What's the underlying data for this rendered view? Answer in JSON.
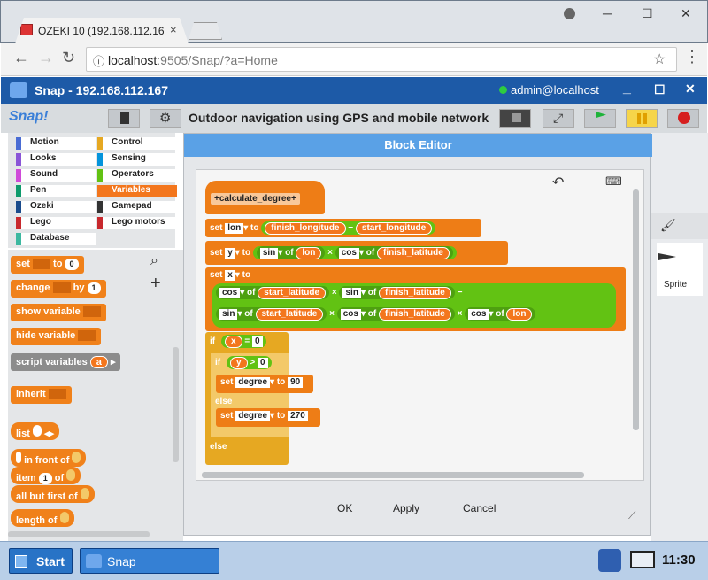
{
  "browser": {
    "tab_title": "OZEKI 10 (192.168.112.16",
    "tab_close": "×",
    "url_host": "localhost",
    "url_path": ":9505/Snap/?a=Home",
    "minimize": "─",
    "maximize": "☐",
    "close": "✕"
  },
  "snap_window": {
    "title": "Snap - 192.168.112.167",
    "user": "admin@localhost",
    "project_title": "Outdoor navigation using GPS and mobile network",
    "logo": "Snap!"
  },
  "categories": [
    {
      "label": "Motion",
      "color": "#4a6cd4"
    },
    {
      "label": "Control",
      "color": "#e6a822"
    },
    {
      "label": "Looks",
      "color": "#8a55d7"
    },
    {
      "label": "Sensing",
      "color": "#0494dc"
    },
    {
      "label": "Sound",
      "color": "#cf4ad9"
    },
    {
      "label": "Operators",
      "color": "#62c213"
    },
    {
      "label": "Pen",
      "color": "#0e9a6c"
    },
    {
      "label": "Variables",
      "color": "#f3761d"
    },
    {
      "label": "Ozeki",
      "color": "#1a4b8c"
    },
    {
      "label": "Gamepad",
      "color": "#333333"
    },
    {
      "label": "Lego",
      "color": "#c8282d"
    },
    {
      "label": "Lego motors",
      "color": "#c8282d"
    },
    {
      "label": "Database",
      "color": "#3cb8a0"
    }
  ],
  "palette": {
    "set": "set",
    "to": "to",
    "set_value": "0",
    "change": "change",
    "by": "by",
    "change_value": "1",
    "show_variable": "show variable",
    "hide_variable": "hide variable",
    "script_variables": "script variables",
    "script_var_a": "a",
    "inherit": "inherit",
    "list": "list",
    "in_front_of": "in front of",
    "item": "item",
    "item_value": "1",
    "of": "of",
    "all_but_first_of": "all but first of",
    "length_of": "length of"
  },
  "dialog": {
    "title": "Block Editor",
    "hat": "+calculate_degree+",
    "set": "set",
    "to": "to",
    "var_lon": "lon",
    "var_y": "y",
    "var_x": "x",
    "finish_longitude": "finish_longitude",
    "start_longitude": "start_longitude",
    "minus": "−",
    "times": "×",
    "sin": "sin",
    "cos": "cos",
    "of": "of",
    "finish_latitude": "finish_latitude",
    "start_latitude": "start_latitude",
    "lon": "lon",
    "if": "if",
    "else": "else",
    "x": "x",
    "y": "y",
    "eq": "=",
    "gt": ">",
    "zero": "0",
    "degree": "degree",
    "ninety": "90",
    "two_seventy": "270",
    "ok": "OK",
    "apply": "Apply",
    "cancel": "Cancel"
  },
  "stage": {
    "sprite_label": "Sprite"
  },
  "taskbar": {
    "start": "Start",
    "snap": "Snap",
    "clock": "11:30"
  }
}
